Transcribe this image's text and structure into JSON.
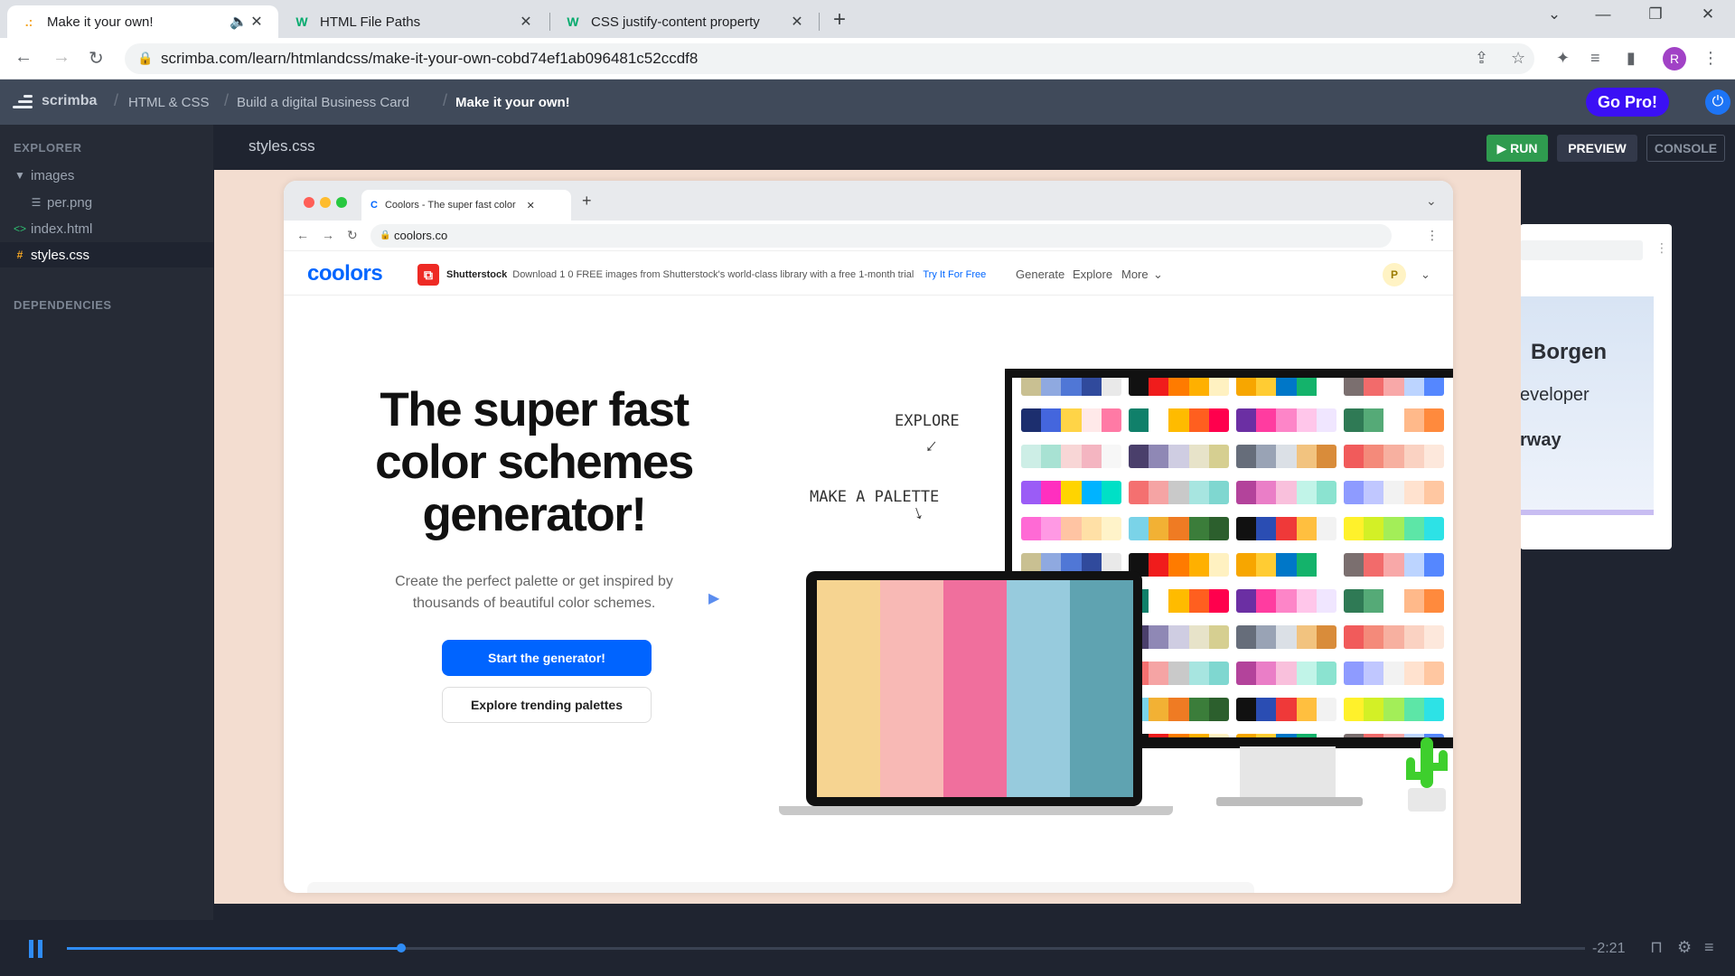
{
  "browser": {
    "tabs": [
      {
        "title": "Make it your own!",
        "favicon": "scrimba"
      },
      {
        "title": "HTML File Paths",
        "favicon": "W"
      },
      {
        "title": "CSS justify-content property",
        "favicon": "W"
      }
    ],
    "url": "scrimba.com/learn/htmlandcss/make-it-your-own-cobd74ef1ab096481c52ccdf8",
    "profile_initial": "R"
  },
  "scrimba": {
    "logo": "scrimba",
    "breadcrumbs": [
      "HTML & CSS",
      "Build a digital Business Card",
      "Make it your own!"
    ],
    "go_pro": "Go Pro!",
    "explorer_label": "EXPLORER",
    "files": [
      {
        "name": "images",
        "type": "folder"
      },
      {
        "name": "per.png",
        "type": "file"
      },
      {
        "name": "index.html",
        "type": "html"
      },
      {
        "name": "styles.css",
        "type": "css"
      }
    ],
    "dependencies_label": "DEPENDENCIES",
    "open_file": "styles.css",
    "run_label": "RUN",
    "preview_label": "PREVIEW",
    "console_label": "CONSOLE",
    "preview_text": [
      "Borgen",
      "eveloper",
      "rway"
    ]
  },
  "screenshot": {
    "tab_title": "Coolors - The super fast color",
    "url": "coolors.co",
    "logo": "coolors",
    "ad_brand": "Shutterstock",
    "ad_text": "Download 1 0 FREE images from Shutterstock's world-class library with a free 1-month trial",
    "ad_link": "Try It For Free",
    "nav": [
      "Generate",
      "Explore",
      "More"
    ],
    "user_initial": "P",
    "headline": "The super fast color schemes generator!",
    "subtext": "Create the perfect palette or get inspired by thousands of beautiful color schemes.",
    "cta_primary": "Start the generator!",
    "cta_secondary": "Explore trending palettes",
    "note_explore": "EXPLORE",
    "note_palette": "MAKE A PALETTE",
    "laptop_palette": [
      "#f6d491",
      "#f8b9b5",
      "#f06f9d",
      "#97cbdd",
      "#5fa3b1"
    ]
  },
  "player": {
    "time": "-2:21",
    "progress": 0.22
  }
}
